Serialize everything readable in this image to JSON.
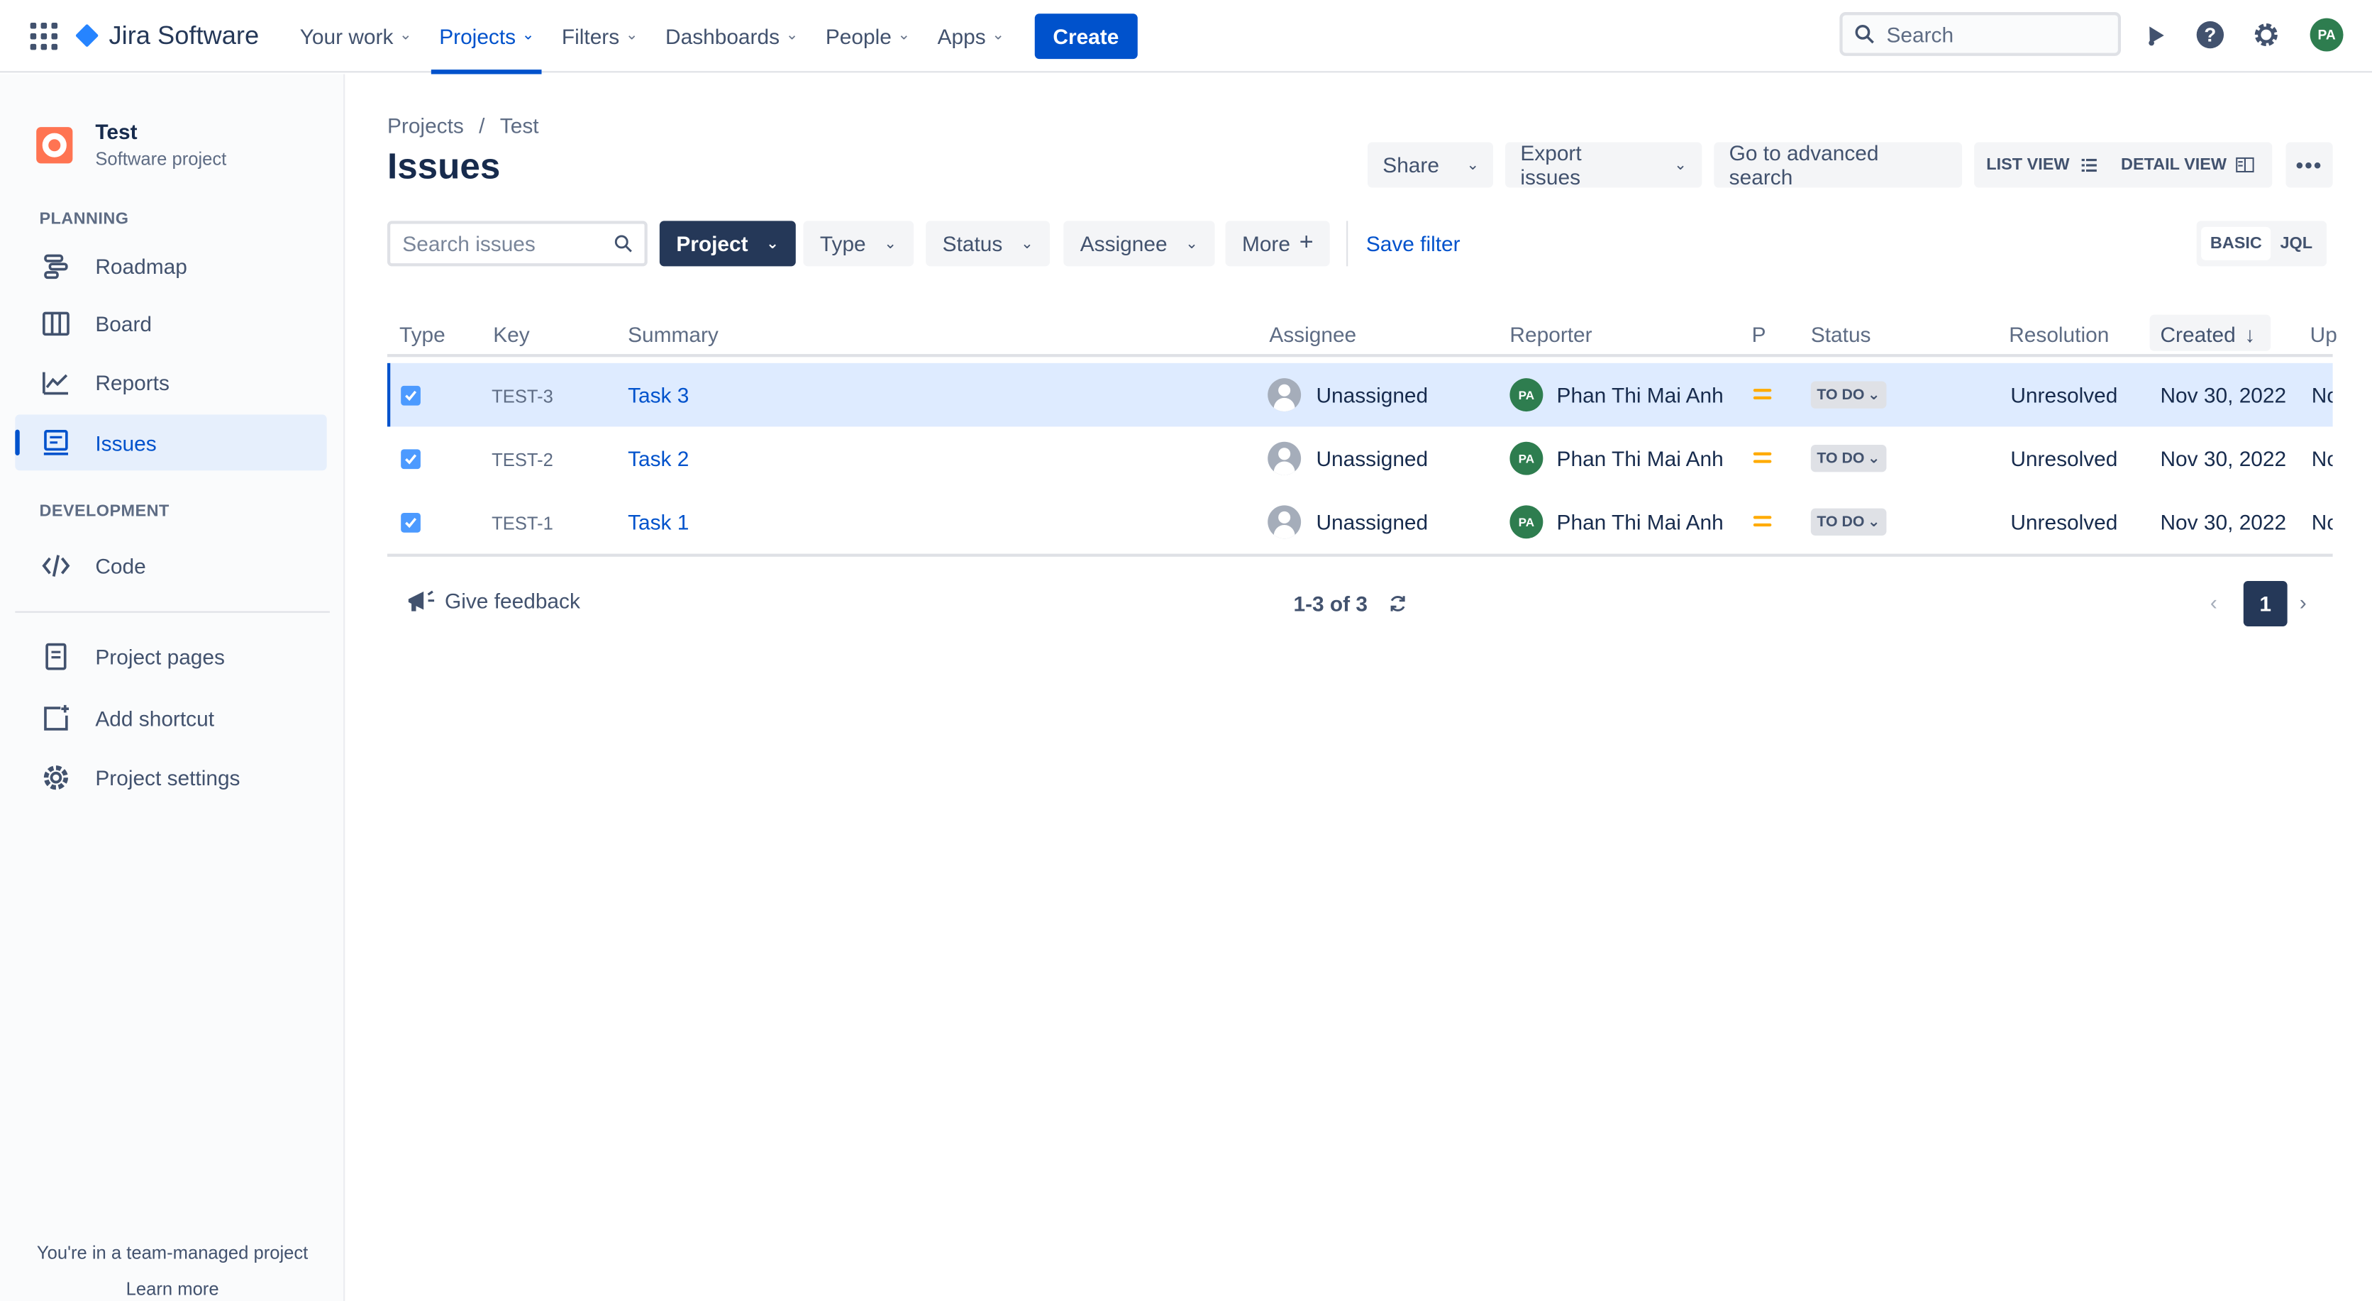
{
  "topnav": {
    "product": "Jira Software",
    "items": [
      {
        "label": "Your work"
      },
      {
        "label": "Projects"
      },
      {
        "label": "Filters"
      },
      {
        "label": "Dashboards"
      },
      {
        "label": "People"
      },
      {
        "label": "Apps"
      }
    ],
    "active_item": "Projects",
    "create_label": "Create",
    "search_placeholder": "Search",
    "user_initials": "PA"
  },
  "sidebar": {
    "project_name": "Test",
    "project_type": "Software project",
    "planning_title": "PLANNING",
    "planning_items": [
      {
        "label": "Roadmap",
        "icon": "roadmap-icon"
      },
      {
        "label": "Board",
        "icon": "board-icon"
      },
      {
        "label": "Reports",
        "icon": "reports-icon"
      },
      {
        "label": "Issues",
        "icon": "issues-icon"
      }
    ],
    "active_item": "Issues",
    "development_title": "DEVELOPMENT",
    "development_items": [
      {
        "label": "Code",
        "icon": "code-icon"
      }
    ],
    "extra_items": [
      {
        "label": "Project pages",
        "icon": "page-icon"
      },
      {
        "label": "Add shortcut",
        "icon": "add-shortcut-icon"
      },
      {
        "label": "Project settings",
        "icon": "gear-icon"
      }
    ],
    "footer_text": "You're in a team-managed project",
    "footer_link": "Learn more"
  },
  "main": {
    "breadcrumb": [
      "Projects",
      "/",
      "Test"
    ],
    "title": "Issues",
    "toolbar": {
      "share": "Share",
      "export": "Export issues",
      "advanced": "Go to advanced search",
      "list_view": "LIST VIEW",
      "detail_view": "DETAIL VIEW"
    },
    "filters": {
      "search_placeholder": "Search issues",
      "project": "Project",
      "type": "Type",
      "status": "Status",
      "assignee": "Assignee",
      "more": "More",
      "save_filter": "Save filter",
      "basic": "BASIC",
      "jql": "JQL"
    },
    "table": {
      "headers": {
        "type": "Type",
        "key": "Key",
        "summary": "Summary",
        "assignee": "Assignee",
        "reporter": "Reporter",
        "priority": "P",
        "status": "Status",
        "resolution": "Resolution",
        "created": "Created",
        "updated": "Up"
      },
      "rows": [
        {
          "key": "TEST-3",
          "summary": "Task 3",
          "assignee": "Unassigned",
          "reporter": "Phan Thi Mai Anh",
          "reporter_initials": "PA",
          "status": "TO DO",
          "resolution": "Unresolved",
          "created": "Nov 30, 2022",
          "updated": "No"
        },
        {
          "key": "TEST-2",
          "summary": "Task 2",
          "assignee": "Unassigned",
          "reporter": "Phan Thi Mai Anh",
          "reporter_initials": "PA",
          "status": "TO DO",
          "resolution": "Unresolved",
          "created": "Nov 30, 2022",
          "updated": "No"
        },
        {
          "key": "TEST-1",
          "summary": "Task 1",
          "assignee": "Unassigned",
          "reporter": "Phan Thi Mai Anh",
          "reporter_initials": "PA",
          "status": "TO DO",
          "resolution": "Unresolved",
          "created": "Nov 30, 2022",
          "updated": "No"
        }
      ],
      "selected_row": 0
    },
    "footer": {
      "feedback": "Give feedback",
      "count": "1-3 of 3",
      "current_page": "1"
    }
  },
  "colors": {
    "primary": "#0052cc",
    "dark_button": "#253858",
    "selected_row": "#deebff",
    "priority_medium": "#ffab00",
    "avatar_green": "#2e7d4f"
  }
}
